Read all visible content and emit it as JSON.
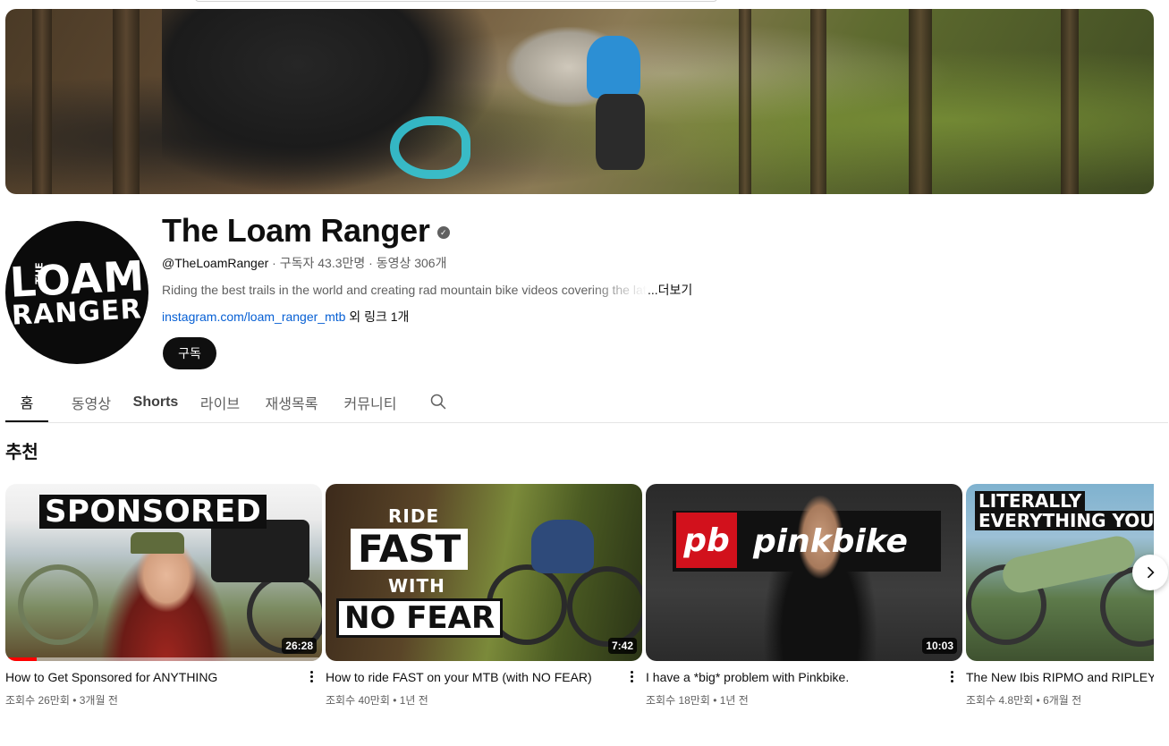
{
  "channel": {
    "name": "The Loam Ranger",
    "handle": "@TheLoamRanger",
    "stats": " · 구독자 43.3만명 · 동영상 306개",
    "description": "Riding the best trails in the world and creating rad mountain bike videos covering the lat",
    "more_label": "...더보기",
    "link": "instagram.com/loam_ranger_mtb",
    "link_extra": " 외 링크 1개",
    "subscribe_label": "구독",
    "avatar_line1": "LOAM",
    "avatar_line2": "RANGER",
    "avatar_small": "THE"
  },
  "tabs": [
    {
      "label": "홈",
      "active": true
    },
    {
      "label": "동영상"
    },
    {
      "label": "Shorts"
    },
    {
      "label": "라이브"
    },
    {
      "label": "재생목록"
    },
    {
      "label": "커뮤니티"
    }
  ],
  "section": {
    "title": "추천"
  },
  "videos": [
    {
      "title": "How to Get Sponsored for ANYTHING",
      "meta": "조회수 26만회 • 3개월 전",
      "duration": "26:28",
      "thumb_text": [
        "SPONSORED"
      ],
      "watched_fraction": 0.1
    },
    {
      "title": "How to ride FAST on your MTB (with NO FEAR)",
      "meta": "조회수 40만회 • 1년 전",
      "duration": "7:42",
      "thumb_text": [
        "RIDE",
        "FAST",
        "WITH",
        "NO FEAR"
      ]
    },
    {
      "title": "I have a *big* problem with Pinkbike.",
      "meta": "조회수 18만회 • 1년 전",
      "duration": "10:03",
      "thumb_text": [
        "pb",
        "pinkbike"
      ]
    },
    {
      "title": "The New Ibis RIPMO and RIPLEY: ",
      "meta": "조회수 4.8만회 • 6개월 전",
      "duration": "",
      "thumb_text": [
        "LITERALLY",
        "EVERYTHING YOU A"
      ]
    }
  ],
  "icons": {
    "verified": "verified-check-icon",
    "search": "search-icon",
    "next": "chevron-right-icon",
    "more": "more-vert-icon"
  },
  "colors": {
    "link": "#065fd4",
    "subscribe_bg": "#0f0f0f",
    "progress": "#ff0000"
  }
}
